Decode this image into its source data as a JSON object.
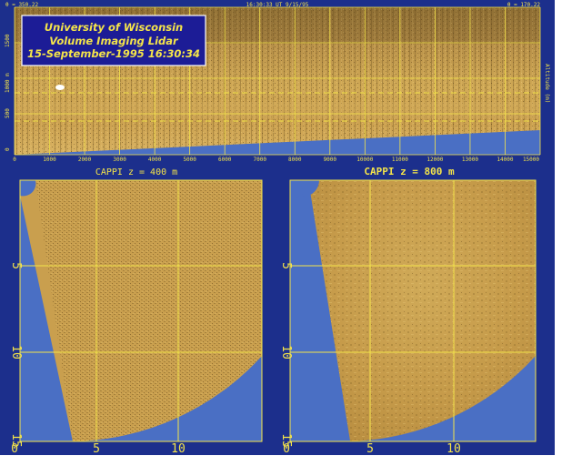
{
  "top_panel": {
    "theta_left": "θ = 350.22",
    "time_label": "16:30:33 UT  9/15/95",
    "theta_right": "θ = 170.22",
    "title_lines": [
      "University of Wisconsin",
      "Volume Imaging Lidar",
      "15-September-1995 16:30:34"
    ],
    "y_ticks": [
      "0",
      "500",
      "1000 m",
      "1500"
    ],
    "x_ticks": [
      "0",
      "1000",
      "2000",
      "3000",
      "4000",
      "5000",
      "6000",
      "7000",
      "8000",
      "9000",
      "10000",
      "11000",
      "12000",
      "13000",
      "14000",
      "15000"
    ],
    "right_label": "Altitude (m)"
  },
  "cappi_left": {
    "title": "CAPPI  z = 400 m",
    "x_ticks": [
      "0",
      "5",
      "10"
    ],
    "y_ticks": [
      "5",
      "10",
      "15"
    ]
  },
  "cappi_right": {
    "title": "CAPPI  z = 800 m",
    "x_ticks": [
      "0",
      "5",
      "10"
    ],
    "y_ticks": [
      "5",
      "10",
      "15"
    ]
  },
  "colors": {
    "frame": "#1c2f8c",
    "background_blue": "#4a6fc4",
    "lidar_tan": "#c8a050",
    "grid_yellow": "#f4e44a",
    "title_box": "#1c1c96"
  }
}
